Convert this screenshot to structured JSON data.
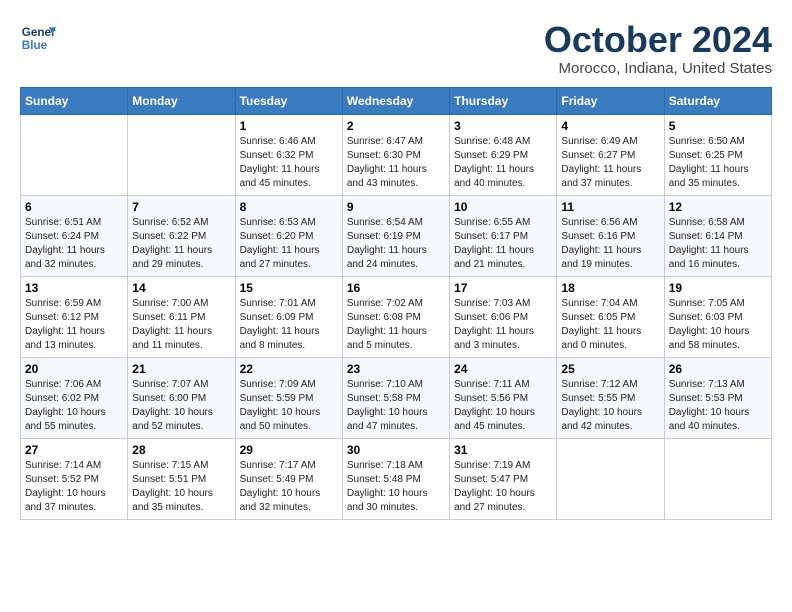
{
  "header": {
    "logo": {
      "line1": "General",
      "line2": "Blue"
    },
    "title": "October 2024",
    "subtitle": "Morocco, Indiana, United States"
  },
  "weekdays": [
    "Sunday",
    "Monday",
    "Tuesday",
    "Wednesday",
    "Thursday",
    "Friday",
    "Saturday"
  ],
  "weeks": [
    [
      {
        "day": "",
        "empty": true
      },
      {
        "day": "",
        "empty": true
      },
      {
        "day": "1",
        "sunrise": "Sunrise: 6:46 AM",
        "sunset": "Sunset: 6:32 PM",
        "daylight": "Daylight: 11 hours and 45 minutes."
      },
      {
        "day": "2",
        "sunrise": "Sunrise: 6:47 AM",
        "sunset": "Sunset: 6:30 PM",
        "daylight": "Daylight: 11 hours and 43 minutes."
      },
      {
        "day": "3",
        "sunrise": "Sunrise: 6:48 AM",
        "sunset": "Sunset: 6:29 PM",
        "daylight": "Daylight: 11 hours and 40 minutes."
      },
      {
        "day": "4",
        "sunrise": "Sunrise: 6:49 AM",
        "sunset": "Sunset: 6:27 PM",
        "daylight": "Daylight: 11 hours and 37 minutes."
      },
      {
        "day": "5",
        "sunrise": "Sunrise: 6:50 AM",
        "sunset": "Sunset: 6:25 PM",
        "daylight": "Daylight: 11 hours and 35 minutes."
      }
    ],
    [
      {
        "day": "6",
        "sunrise": "Sunrise: 6:51 AM",
        "sunset": "Sunset: 6:24 PM",
        "daylight": "Daylight: 11 hours and 32 minutes."
      },
      {
        "day": "7",
        "sunrise": "Sunrise: 6:52 AM",
        "sunset": "Sunset: 6:22 PM",
        "daylight": "Daylight: 11 hours and 29 minutes."
      },
      {
        "day": "8",
        "sunrise": "Sunrise: 6:53 AM",
        "sunset": "Sunset: 6:20 PM",
        "daylight": "Daylight: 11 hours and 27 minutes."
      },
      {
        "day": "9",
        "sunrise": "Sunrise: 6:54 AM",
        "sunset": "Sunset: 6:19 PM",
        "daylight": "Daylight: 11 hours and 24 minutes."
      },
      {
        "day": "10",
        "sunrise": "Sunrise: 6:55 AM",
        "sunset": "Sunset: 6:17 PM",
        "daylight": "Daylight: 11 hours and 21 minutes."
      },
      {
        "day": "11",
        "sunrise": "Sunrise: 6:56 AM",
        "sunset": "Sunset: 6:16 PM",
        "daylight": "Daylight: 11 hours and 19 minutes."
      },
      {
        "day": "12",
        "sunrise": "Sunrise: 6:58 AM",
        "sunset": "Sunset: 6:14 PM",
        "daylight": "Daylight: 11 hours and 16 minutes."
      }
    ],
    [
      {
        "day": "13",
        "sunrise": "Sunrise: 6:59 AM",
        "sunset": "Sunset: 6:12 PM",
        "daylight": "Daylight: 11 hours and 13 minutes."
      },
      {
        "day": "14",
        "sunrise": "Sunrise: 7:00 AM",
        "sunset": "Sunset: 6:11 PM",
        "daylight": "Daylight: 11 hours and 11 minutes."
      },
      {
        "day": "15",
        "sunrise": "Sunrise: 7:01 AM",
        "sunset": "Sunset: 6:09 PM",
        "daylight": "Daylight: 11 hours and 8 minutes."
      },
      {
        "day": "16",
        "sunrise": "Sunrise: 7:02 AM",
        "sunset": "Sunset: 6:08 PM",
        "daylight": "Daylight: 11 hours and 5 minutes."
      },
      {
        "day": "17",
        "sunrise": "Sunrise: 7:03 AM",
        "sunset": "Sunset: 6:06 PM",
        "daylight": "Daylight: 11 hours and 3 minutes."
      },
      {
        "day": "18",
        "sunrise": "Sunrise: 7:04 AM",
        "sunset": "Sunset: 6:05 PM",
        "daylight": "Daylight: 11 hours and 0 minutes."
      },
      {
        "day": "19",
        "sunrise": "Sunrise: 7:05 AM",
        "sunset": "Sunset: 6:03 PM",
        "daylight": "Daylight: 10 hours and 58 minutes."
      }
    ],
    [
      {
        "day": "20",
        "sunrise": "Sunrise: 7:06 AM",
        "sunset": "Sunset: 6:02 PM",
        "daylight": "Daylight: 10 hours and 55 minutes."
      },
      {
        "day": "21",
        "sunrise": "Sunrise: 7:07 AM",
        "sunset": "Sunset: 6:00 PM",
        "daylight": "Daylight: 10 hours and 52 minutes."
      },
      {
        "day": "22",
        "sunrise": "Sunrise: 7:09 AM",
        "sunset": "Sunset: 5:59 PM",
        "daylight": "Daylight: 10 hours and 50 minutes."
      },
      {
        "day": "23",
        "sunrise": "Sunrise: 7:10 AM",
        "sunset": "Sunset: 5:58 PM",
        "daylight": "Daylight: 10 hours and 47 minutes."
      },
      {
        "day": "24",
        "sunrise": "Sunrise: 7:11 AM",
        "sunset": "Sunset: 5:56 PM",
        "daylight": "Daylight: 10 hours and 45 minutes."
      },
      {
        "day": "25",
        "sunrise": "Sunrise: 7:12 AM",
        "sunset": "Sunset: 5:55 PM",
        "daylight": "Daylight: 10 hours and 42 minutes."
      },
      {
        "day": "26",
        "sunrise": "Sunrise: 7:13 AM",
        "sunset": "Sunset: 5:53 PM",
        "daylight": "Daylight: 10 hours and 40 minutes."
      }
    ],
    [
      {
        "day": "27",
        "sunrise": "Sunrise: 7:14 AM",
        "sunset": "Sunset: 5:52 PM",
        "daylight": "Daylight: 10 hours and 37 minutes."
      },
      {
        "day": "28",
        "sunrise": "Sunrise: 7:15 AM",
        "sunset": "Sunset: 5:51 PM",
        "daylight": "Daylight: 10 hours and 35 minutes."
      },
      {
        "day": "29",
        "sunrise": "Sunrise: 7:17 AM",
        "sunset": "Sunset: 5:49 PM",
        "daylight": "Daylight: 10 hours and 32 minutes."
      },
      {
        "day": "30",
        "sunrise": "Sunrise: 7:18 AM",
        "sunset": "Sunset: 5:48 PM",
        "daylight": "Daylight: 10 hours and 30 minutes."
      },
      {
        "day": "31",
        "sunrise": "Sunrise: 7:19 AM",
        "sunset": "Sunset: 5:47 PM",
        "daylight": "Daylight: 10 hours and 27 minutes."
      },
      {
        "day": "",
        "empty": true
      },
      {
        "day": "",
        "empty": true
      }
    ]
  ]
}
